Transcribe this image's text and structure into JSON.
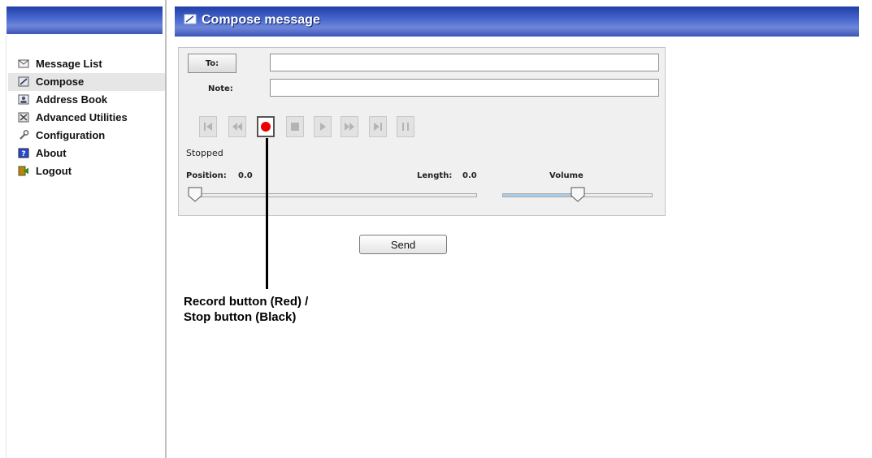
{
  "sidebar": {
    "items": [
      {
        "label": "Message List",
        "icon": "envelope-icon"
      },
      {
        "label": "Compose",
        "icon": "compose-icon",
        "active": true
      },
      {
        "label": "Address Book",
        "icon": "address-book-icon"
      },
      {
        "label": "Advanced Utilities",
        "icon": "utilities-icon"
      },
      {
        "label": "Configuration",
        "icon": "wrench-icon"
      },
      {
        "label": "About",
        "icon": "help-icon"
      },
      {
        "label": "Logout",
        "icon": "logout-icon"
      }
    ]
  },
  "header": {
    "title": "Compose message"
  },
  "form": {
    "to_button_label": "To:",
    "to_value": "",
    "note_label": "Note:",
    "note_value": ""
  },
  "player": {
    "controls": [
      "first-icon",
      "rewind-icon",
      "record-icon",
      "stop-icon",
      "play-icon",
      "fast-forward-icon",
      "last-icon",
      "pause-icon"
    ],
    "status": "Stopped",
    "position_label": "Position:",
    "position_value": "0.0",
    "length_label": "Length:",
    "length_value": "0.0",
    "volume_label": "Volume",
    "volume_level": 0.5
  },
  "send_label": "Send",
  "annotation": {
    "line1": "Record button (Red) /",
    "line2": "Stop button (Black)"
  },
  "colors": {
    "banner": "#2a48b4",
    "record": "#ee0000"
  }
}
